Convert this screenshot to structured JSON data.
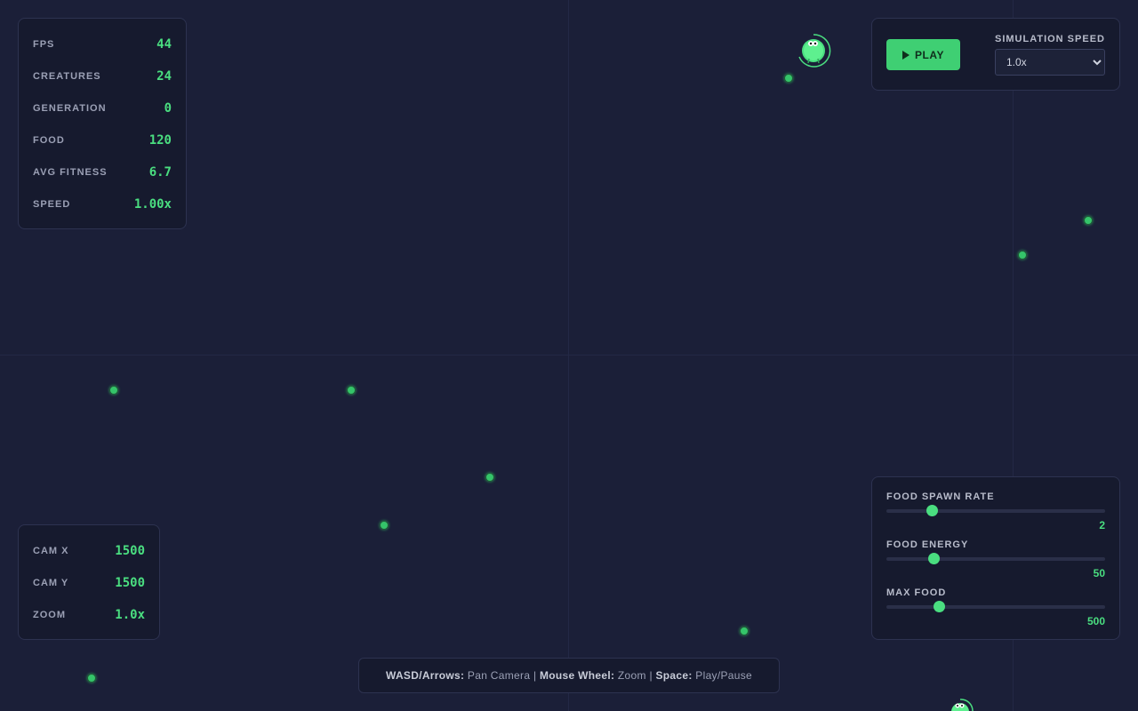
{
  "stats": [
    {
      "label": "FPS",
      "value": "44"
    },
    {
      "label": "CREATURES",
      "value": "24"
    },
    {
      "label": "GENERATION",
      "value": "0"
    },
    {
      "label": "FOOD",
      "value": "120"
    },
    {
      "label": "AVG FITNESS",
      "value": "6.7"
    },
    {
      "label": "SPEED",
      "value": "1.00x"
    }
  ],
  "camera": [
    {
      "label": "CAM X",
      "value": "1500"
    },
    {
      "label": "CAM Y",
      "value": "1500"
    },
    {
      "label": "ZOOM",
      "value": "1.0x"
    }
  ],
  "controls": {
    "play_label": "PLAY",
    "speed_label": "SIMULATION SPEED",
    "speed_selected": "1.0x",
    "play_icon": "play-icon"
  },
  "sliders": [
    {
      "label": "FOOD SPAWN RATE",
      "value": "2",
      "fraction": 0.21
    },
    {
      "label": "FOOD ENERGY",
      "value": "50",
      "fraction": 0.22
    },
    {
      "label": "MAX FOOD",
      "value": "500",
      "fraction": 0.245
    }
  ],
  "help": {
    "k1": "WASD/Arrows:",
    "d1": "Pan Camera",
    "k2": "Mouse Wheel:",
    "d2": "Zoom",
    "k3": "Space:",
    "d3": "Play/Pause",
    "sep": "|"
  },
  "colors": {
    "background": "#1b1f38",
    "accent": "#4ade80",
    "food": "#35c46a",
    "panel": "#161a2e"
  }
}
